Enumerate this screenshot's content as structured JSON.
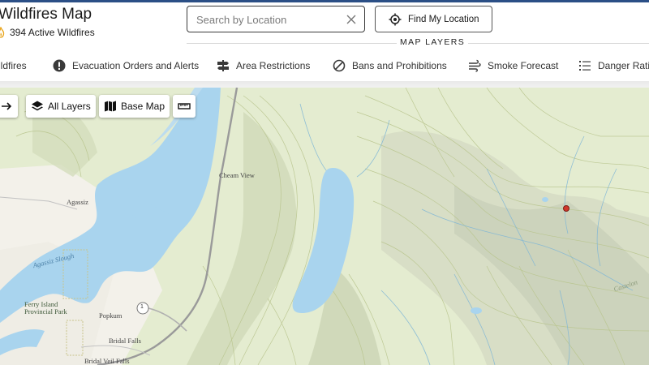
{
  "header": {
    "title": "Wildfires Map",
    "active_count": "394 Active Wildfires"
  },
  "search": {
    "placeholder": "Search by Location"
  },
  "locate": {
    "label": "Find My Location"
  },
  "map_layers": {
    "title": "MAP LAYERS",
    "tabs": [
      {
        "label": "ildfires",
        "icon": "flame-icon"
      },
      {
        "label": "Evacuation Orders and Alerts",
        "icon": "alert-icon"
      },
      {
        "label": "Area Restrictions",
        "icon": "signpost-icon"
      },
      {
        "label": "Bans and Prohibitions",
        "icon": "ban-icon"
      },
      {
        "label": "Smoke Forecast",
        "icon": "smoke-icon"
      },
      {
        "label": "Danger Ratin",
        "icon": "list-icon"
      }
    ]
  },
  "map_controls": {
    "all_layers": "All Layers",
    "base_map": "Base Map"
  },
  "map_labels": {
    "cheam_view": "Cheam View",
    "agassiz": "Agassiz",
    "agassiz_slough": "Agassiz Slough",
    "ferry_island": "Ferry Island",
    "provincial_park": "Provincial Park",
    "popkum": "Popkum",
    "bridal_falls": "Bridal Falls",
    "bridal_veil_falls": "Bridal Veil Falls",
    "castelon": "Castelon",
    "highway": "1"
  },
  "colors": {
    "accent_bar": "#2b4f86",
    "water": "#a9d4ee",
    "land": "#e4ecd0",
    "fire_marker": "#d0372b"
  }
}
